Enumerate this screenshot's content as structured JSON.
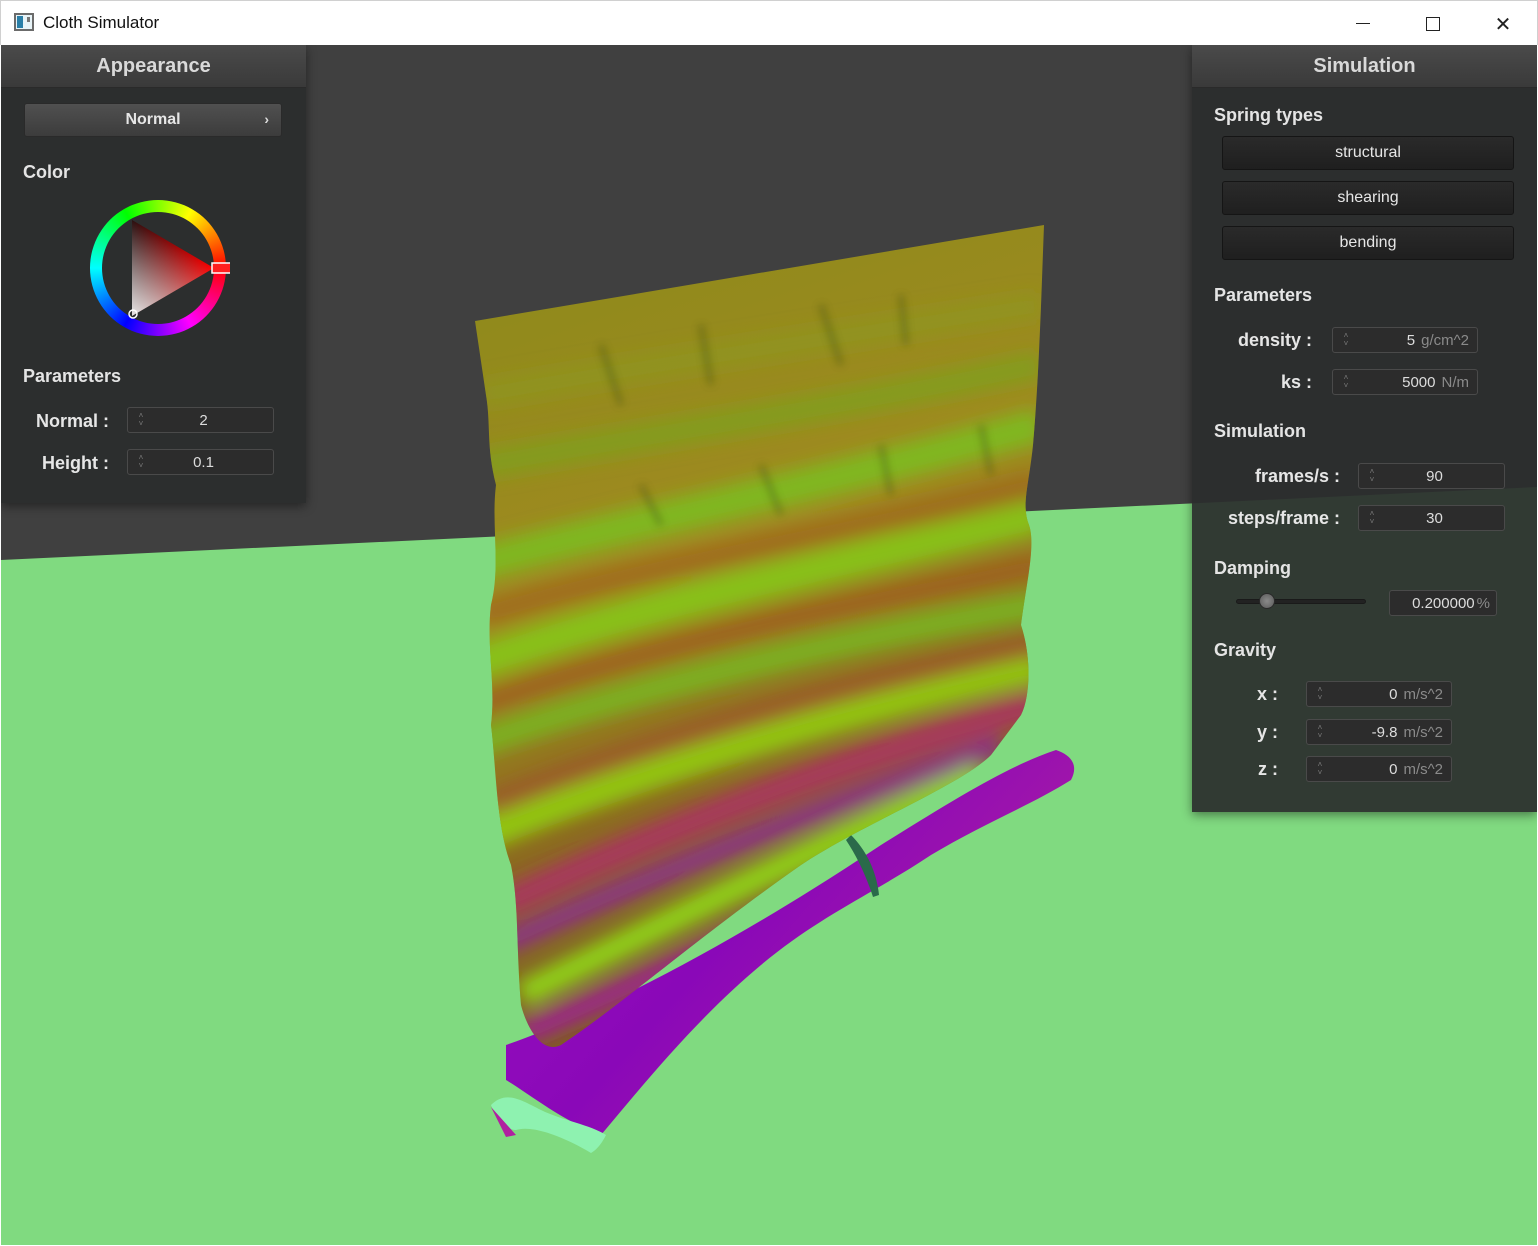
{
  "window": {
    "title": "Cloth Simulator"
  },
  "appearance": {
    "title": "Appearance",
    "shader_select": "Normal",
    "color_label": "Color",
    "selected_color": "#ff0000",
    "parameters_label": "Parameters",
    "normal_label": "Normal :",
    "normal_value": "2",
    "height_label": "Height :",
    "height_value": "0.1"
  },
  "simulation": {
    "title": "Simulation",
    "spring_types_label": "Spring types",
    "spring_buttons": [
      "structural",
      "shearing",
      "bending"
    ],
    "parameters_label": "Parameters",
    "density_label": "density :",
    "density_value": "5",
    "density_unit": "g/cm^2",
    "ks_label": "ks :",
    "ks_value": "5000",
    "ks_unit": "N/m",
    "simulation_label": "Simulation",
    "fps_label": "frames/s :",
    "fps_value": "90",
    "steps_label": "steps/frame :",
    "steps_value": "30",
    "damping_label": "Damping",
    "damping_value": "0.200000",
    "damping_unit": "%",
    "damping_fraction": 0.2,
    "gravity_label": "Gravity",
    "gx_label": "x :",
    "gx_value": "0",
    "gy_label": "y :",
    "gy_value": "-9.8",
    "gz_label": "z :",
    "gz_value": "0",
    "gravity_unit": "m/s^2"
  },
  "scene": {
    "background_color": "#404040",
    "floor_color": "#80da80"
  }
}
